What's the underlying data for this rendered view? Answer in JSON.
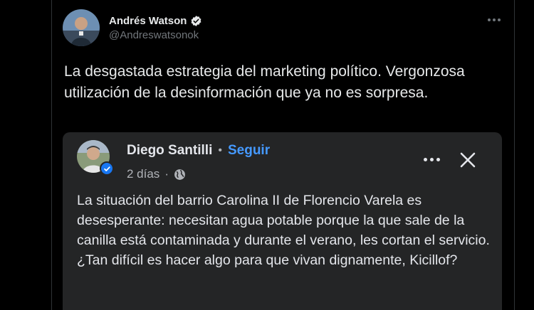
{
  "tweet": {
    "author_name": "Andrés Watson",
    "author_handle": "@Andreswatsonok",
    "text": "La desgastada estrategia del marketing político. Vergonzosa utilización de la desinformación que ya no es sorpresa.",
    "more_icon": "ellipsis-icon"
  },
  "embed": {
    "author_name": "Diego Santilli",
    "separator": "•",
    "follow_label": "Seguir",
    "time": "2 días",
    "meta_separator": "·",
    "text": "La situación del barrio Carolina II de Florencio Varela es desesperante: necesitan agua potable porque la que sale de la canilla está contaminada y durante el verano, les cortan el servicio. ¿Tan difícil es hacer algo para que vivan dignamente, Kicillof?"
  },
  "colors": {
    "background": "#000000",
    "card": "#242526",
    "follow_blue": "#4599ff",
    "verified_blue": "#1877f2",
    "muted": "#71767b"
  }
}
